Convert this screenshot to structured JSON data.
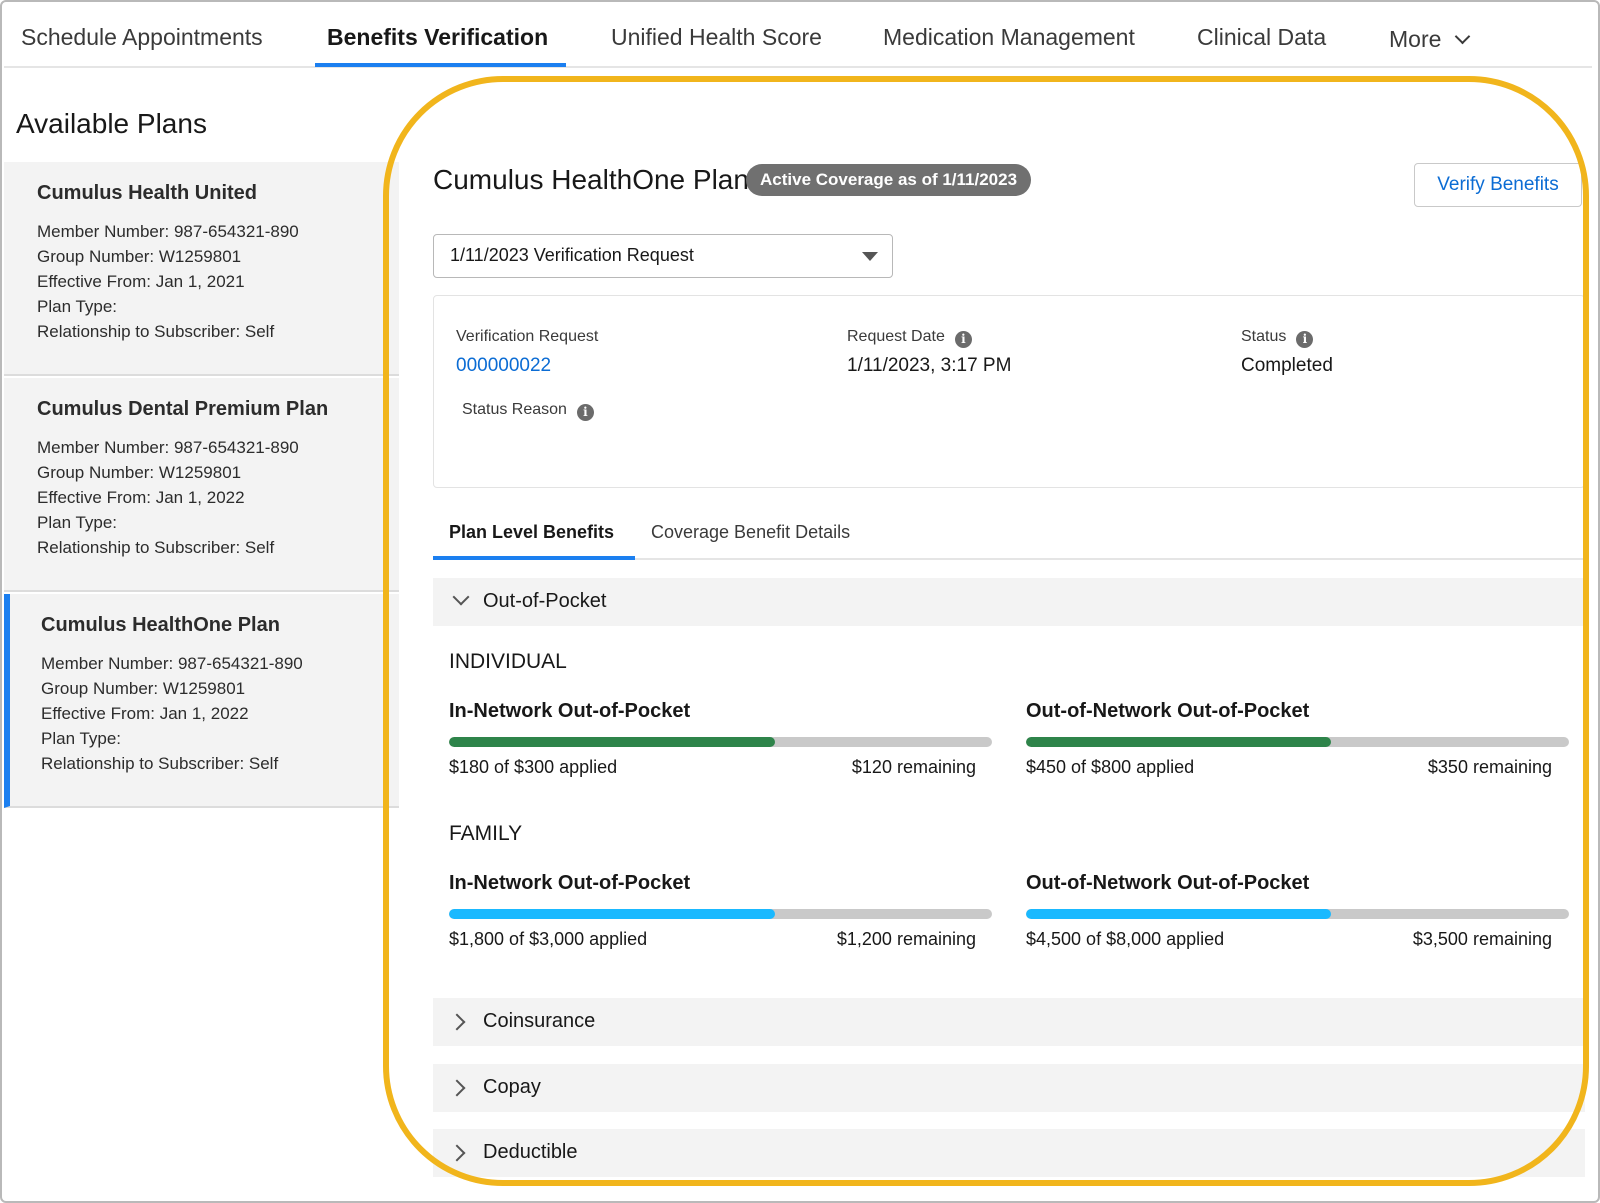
{
  "topnav": {
    "tabs": [
      {
        "label": "Schedule Appointments"
      },
      {
        "label": "Benefits Verification"
      },
      {
        "label": "Unified Health Score"
      },
      {
        "label": "Medication Management"
      },
      {
        "label": "Clinical Data"
      },
      {
        "label": "More"
      }
    ],
    "active_tab": "Benefits Verification"
  },
  "sidebar": {
    "title": "Available Plans",
    "plans": [
      {
        "name": "Cumulus Health United",
        "member_number": "Member Number: 987-654321-890",
        "group_number": "Group Number: W1259801",
        "effective_from": "Effective From: Jan 1, 2021",
        "plan_type": "Plan Type:",
        "relationship": "Relationship to Subscriber: Self"
      },
      {
        "name": "Cumulus Dental Premium Plan",
        "member_number": "Member Number: 987-654321-890",
        "group_number": "Group Number: W1259801",
        "effective_from": "Effective From: Jan 1, 2022",
        "plan_type": "Plan Type:",
        "relationship": "Relationship to Subscriber: Self"
      },
      {
        "name": "Cumulus HealthOne Plan",
        "member_number": "Member Number: 987-654321-890",
        "group_number": "Group Number: W1259801",
        "effective_from": "Effective From: Jan 1, 2022",
        "plan_type": "Plan Type:",
        "relationship": "Relationship to Subscriber: Self"
      }
    ]
  },
  "main": {
    "title": "Cumulus HealthOne Plan",
    "coverage_badge": "Active Coverage as of 1/11/2023",
    "verify_button": "Verify Benefits",
    "request_select": "1/11/2023 Verification Request",
    "details": {
      "verification_request_label": "Verification Request",
      "verification_request_value": "000000022",
      "request_date_label": "Request Date",
      "request_date_value": "1/11/2023, 3:17 PM",
      "status_label": "Status",
      "status_value": "Completed",
      "status_reason_label": "Status Reason"
    },
    "subtabs": [
      "Plan Level Benefits",
      "Coverage Benefit Details"
    ],
    "sections": {
      "out_of_pocket": "Out-of-Pocket",
      "coinsurance": "Coinsurance",
      "copay": "Copay",
      "deductible": "Deductible"
    },
    "individual": {
      "title": "INDIVIDUAL",
      "in_network": {
        "title": "In-Network Out-of-Pocket",
        "applied_text": "$180 of $300 applied",
        "remaining_text": "$120 remaining",
        "fraction": 0.6
      },
      "out_network": {
        "title": "Out-of-Network Out-of-Pocket",
        "applied_text": "$450 of $800 applied",
        "remaining_text": "$350 remaining",
        "fraction": 0.5625
      }
    },
    "family": {
      "title": "FAMILY",
      "in_network": {
        "title": "In-Network Out-of-Pocket",
        "applied_text": "$1,800 of $3,000 applied",
        "remaining_text": "$1,200 remaining",
        "fraction": 0.6
      },
      "out_network": {
        "title": "Out-of-Network Out-of-Pocket",
        "applied_text": "$4,500 of $8,000 applied",
        "remaining_text": "$3,500 remaining",
        "fraction": 0.5625
      }
    }
  },
  "colors": {
    "accent_blue": "#1b7ff0",
    "link_blue": "#0b6cd4",
    "individual_bar": "#2e844a",
    "family_bar": "#1ab9ff",
    "highlight_ring": "#f1b51c"
  }
}
